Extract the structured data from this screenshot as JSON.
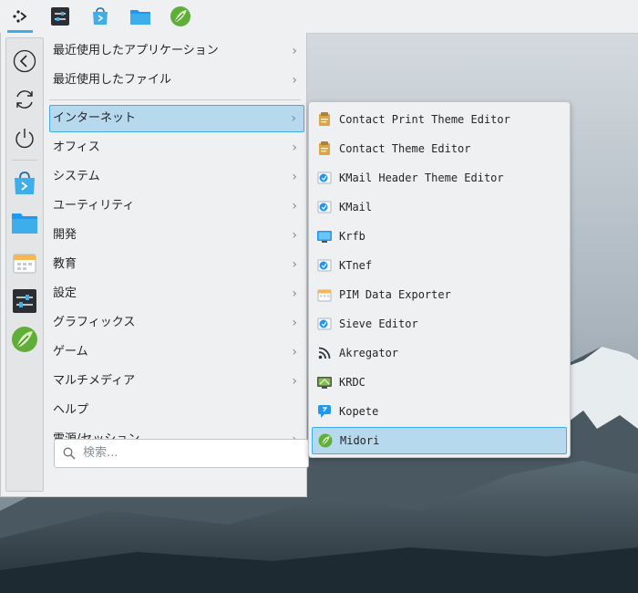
{
  "colors": {
    "accent": "#3daee9",
    "highlight": "#b7d9ee",
    "panel": "#eff0f1",
    "text": "#232629"
  },
  "panel": {
    "launchers": [
      {
        "name": "application-launcher-icon"
      },
      {
        "name": "system-settings-icon"
      },
      {
        "name": "discover-store-icon"
      },
      {
        "name": "dolphin-folder-icon"
      },
      {
        "name": "midori-browser-icon"
      }
    ]
  },
  "favorites": [
    {
      "name": "back-icon"
    },
    {
      "name": "refresh-icon"
    },
    {
      "name": "power-icon"
    },
    {
      "name": "discover-store-icon"
    },
    {
      "name": "dolphin-folder-icon"
    },
    {
      "name": "pim-data-exporter-icon"
    },
    {
      "name": "system-settings-icon"
    },
    {
      "name": "midori-browser-icon"
    }
  ],
  "menu": {
    "items": [
      {
        "label": "最近使用したアプリケーション",
        "submenu": true
      },
      {
        "label": "最近使用したファイル",
        "submenu": true
      },
      {
        "label": "インターネット",
        "submenu": true,
        "highlighted": true
      },
      {
        "label": "オフィス",
        "submenu": true
      },
      {
        "label": "システム",
        "submenu": true
      },
      {
        "label": "ユーティリティ",
        "submenu": true
      },
      {
        "label": "開発",
        "submenu": true
      },
      {
        "label": "教育",
        "submenu": true
      },
      {
        "label": "設定",
        "submenu": true
      },
      {
        "label": "グラフィックス",
        "submenu": true
      },
      {
        "label": "ゲーム",
        "submenu": true
      },
      {
        "label": "マルチメディア",
        "submenu": true
      },
      {
        "label": "ヘルプ",
        "submenu": false
      },
      {
        "label": "電源/セッション",
        "submenu": true
      }
    ],
    "chevron": "›",
    "search_placeholder": "検索..."
  },
  "submenu": {
    "items": [
      {
        "label": "Contact Print Theme Editor",
        "icon": "theme-editor-icon"
      },
      {
        "label": "Contact Theme Editor",
        "icon": "theme-editor-icon"
      },
      {
        "label": "KMail Header Theme Editor",
        "icon": "kmail-icon"
      },
      {
        "label": "KMail",
        "icon": "kmail-icon"
      },
      {
        "label": "Krfb",
        "icon": "krfb-icon"
      },
      {
        "label": "KTnef",
        "icon": "kmail-icon"
      },
      {
        "label": "PIM Data Exporter",
        "icon": "pim-data-exporter-icon"
      },
      {
        "label": "Sieve Editor",
        "icon": "kmail-icon"
      },
      {
        "label": "Akregator",
        "icon": "rss-feed-icon"
      },
      {
        "label": "KRDC",
        "icon": "krdc-icon"
      },
      {
        "label": "Kopete",
        "icon": "kopete-icon"
      },
      {
        "label": "Midori",
        "icon": "midori-browser-icon",
        "highlighted": true
      }
    ]
  }
}
